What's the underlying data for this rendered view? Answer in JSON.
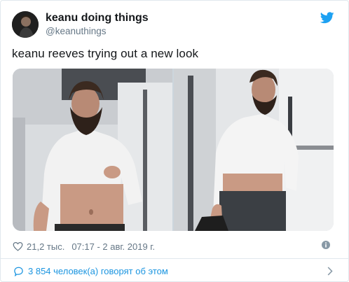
{
  "author": {
    "name": "keanu doing things",
    "handle": "@keanuthings"
  },
  "tweet": {
    "text": "keanu reeves trying out a new look"
  },
  "media": {
    "photos": [
      {
        "icon": "photo-keanu-shirt-lifted"
      },
      {
        "icon": "photo-keanu-walking"
      }
    ]
  },
  "stats": {
    "likes": "21,2 тыс.",
    "timestamp": "07:17 - 2 авг. 2019 г."
  },
  "conversation": {
    "label": "3 854 человек(а) говорят об этом"
  },
  "colors": {
    "accent": "#1b95e0",
    "twitter_blue": "#1da1f2",
    "muted": "#657786",
    "border": "#e1e8ed"
  },
  "icons": {
    "logo": "twitter-bird-icon",
    "like": "heart-icon",
    "info": "info-icon",
    "reply": "speech-bubble-icon",
    "more": "chevron-right-icon"
  }
}
